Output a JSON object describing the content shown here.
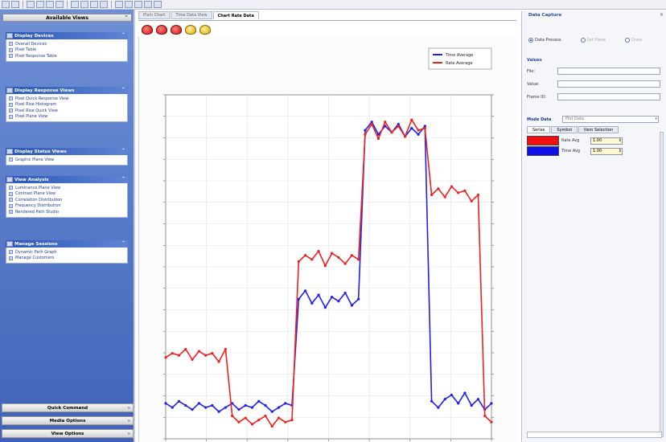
{
  "toolbar": {
    "buttons": [
      "save-icon",
      "edit-icon",
      "search-icon",
      "tool-icon",
      "chart-icon",
      "chart2-icon",
      "globe-icon",
      "print-icon",
      "grid-icon",
      "settings-icon",
      "refresh-icon",
      "export-icon",
      "help-icon",
      "key-icon",
      "info-icon"
    ]
  },
  "left_panel": {
    "header": "Available Views",
    "groups": [
      {
        "title": "Display Devices",
        "items": [
          "Overall Devices",
          "Pixel Table",
          "Pixel Response Table"
        ]
      },
      {
        "title": "Display Response Views",
        "items": [
          "Pixel Quick Response View",
          "Pixel Rise Histogram",
          "Pixel Rise Quick View",
          "Pixel Plane View"
        ]
      },
      {
        "title": "Display Status Views",
        "items": [
          "Graphic Plane View"
        ]
      },
      {
        "title": "View Analysis",
        "items": [
          "Luminance Plane View",
          "Contrast Plane View",
          "Correlation Distribution",
          "Frequency Distribution",
          "Rendered Path Studio"
        ]
      },
      {
        "title": "Manage Sessions",
        "items": [
          "Dynamic Path Graph",
          "Manage Customers"
        ]
      }
    ],
    "bottom_buttons": [
      "Quick Command",
      "Media Options",
      "View Options"
    ]
  },
  "tabs": [
    {
      "label": "Plain Chart",
      "active": false
    },
    {
      "label": "Time Data View",
      "active": false
    },
    {
      "label": "Chart Rate Data",
      "active": true
    }
  ],
  "chart_toolbar": [
    "record-icon",
    "record2-icon",
    "record3-icon",
    "lock-icon",
    "key-icon"
  ],
  "chart_data": {
    "type": "line",
    "legend": [
      "Time Average",
      "Rate Average"
    ],
    "legend_position": "top-right",
    "series": [
      {
        "name": "Time Average",
        "color": "#2020ee",
        "values": [
          5.2,
          5.0,
          5.3,
          5.1,
          4.9,
          5.2,
          5.0,
          5.1,
          4.8,
          5.0,
          5.2,
          4.9,
          5.1,
          5.0,
          5.3,
          5.1,
          4.8,
          5.0,
          5.2,
          5.1,
          10.2,
          10.6,
          10.0,
          10.4,
          9.8,
          10.3,
          10.1,
          10.5,
          9.9,
          10.2,
          18.3,
          18.7,
          18.1,
          18.5,
          18.2,
          18.6,
          18.0,
          18.4,
          18.1,
          18.5,
          5.3,
          5.0,
          5.4,
          5.6,
          5.2,
          5.7,
          5.1,
          5.4,
          4.9,
          5.2
        ]
      },
      {
        "name": "Rate Average",
        "color": "#ee2020",
        "values": [
          7.4,
          7.6,
          7.5,
          7.8,
          7.3,
          7.7,
          7.5,
          7.6,
          7.2,
          7.8,
          4.6,
          4.3,
          4.5,
          4.2,
          4.4,
          4.6,
          4.1,
          4.5,
          4.3,
          4.4,
          12.0,
          12.3,
          12.1,
          12.5,
          11.8,
          12.4,
          12.2,
          11.9,
          12.3,
          12.1,
          18.1,
          18.6,
          17.9,
          18.7,
          18.2,
          18.5,
          18.0,
          18.8,
          18.3,
          18.4,
          15.2,
          15.5,
          15.1,
          15.6,
          15.3,
          15.4,
          14.9,
          15.2,
          4.6,
          4.3
        ]
      }
    ],
    "ylim": [
      3.5,
      20
    ],
    "grid": true
  },
  "right_panel": {
    "title": "Data Capture",
    "radios": [
      {
        "label": "Data Process",
        "on": true
      },
      {
        "label": "Set Plane",
        "on": false
      },
      {
        "label": "Draw",
        "on": false
      }
    ],
    "values_section": "Values",
    "fields": [
      {
        "label": "File:",
        "value": ""
      },
      {
        "label": "Value:",
        "value": ""
      },
      {
        "label": "Frame ID:",
        "value": ""
      }
    ],
    "mode_label": "Mode Data",
    "mode_value": "Plot Data",
    "sub_tabs": [
      "Series",
      "Symbol",
      "Item Selection"
    ],
    "series_rows": [
      {
        "color": "#ee1010",
        "name": "Rate Avg",
        "value": "1.00"
      },
      {
        "color": "#1010ee",
        "name": "Time Avg",
        "value": "1.00"
      }
    ]
  }
}
